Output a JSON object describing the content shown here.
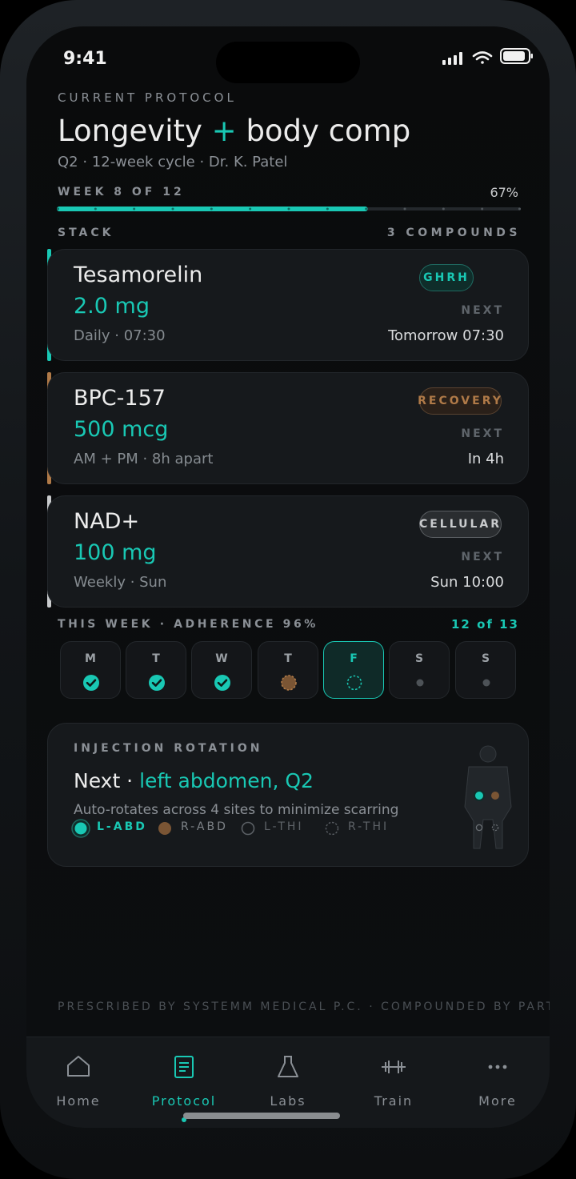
{
  "status": {
    "time": "9:41"
  },
  "header": {
    "eyebrow": "CURRENT PROTOCOL",
    "title_part1": "Longevity",
    "title_plus": "+",
    "title_part2": "body comp",
    "subtitle": "Q2 · 12-week cycle · Dr. K. Patel",
    "week_label": "WEEK 8 OF 12",
    "progress_label": "67%",
    "progress_fraction": 0.67,
    "weeks_total": 12
  },
  "stack": {
    "label": "STACK",
    "count_label": "3 COMPOUNDS",
    "next_label": "NEXT",
    "items": [
      {
        "name": "Tesamorelin",
        "dose": "2.0 mg",
        "schedule": "Daily · 07:30",
        "badge": "GHRH",
        "next": "Tomorrow 07:30",
        "accent": "#19c8b4"
      },
      {
        "name": "BPC-157",
        "dose": "500 mcg",
        "schedule": "AM + PM · 8h apart",
        "badge": "RECOVERY",
        "next": "In 4h",
        "accent": "#b07a48"
      },
      {
        "name": "NAD+",
        "dose": "100 mg",
        "schedule": "Weekly · Sun",
        "badge": "CELLULAR",
        "next": "Sun 10:00",
        "accent": "#c9cbcd"
      }
    ]
  },
  "week": {
    "label": "THIS WEEK · ADHERENCE 96%",
    "count": "12 of 13",
    "days": [
      {
        "letter": "M",
        "state": "done"
      },
      {
        "letter": "T",
        "state": "done"
      },
      {
        "letter": "W",
        "state": "done"
      },
      {
        "letter": "T",
        "state": "partial"
      },
      {
        "letter": "F",
        "state": "today"
      },
      {
        "letter": "S",
        "state": "upcoming"
      },
      {
        "letter": "S",
        "state": "upcoming"
      }
    ]
  },
  "rotation": {
    "label": "INJECTION ROTATION",
    "next_prefix": "Next ·",
    "next_site": "left abdomen, Q2",
    "description": "Auto-rotates across 4 sites to minimize scarring",
    "sites": [
      "L-ABD",
      "R-ABD",
      "L-THI",
      "R-THI"
    ]
  },
  "footer": {
    "text": "PRESCRIBED BY SYSTEMM MEDICAL P.C. · COMPOUNDED BY PARTNER PHARMACY"
  },
  "nav": {
    "items": [
      {
        "label": "Home",
        "icon": "home-icon"
      },
      {
        "label": "Protocol",
        "icon": "document-icon"
      },
      {
        "label": "Labs",
        "icon": "flask-icon"
      },
      {
        "label": "Train",
        "icon": "dumbbell-icon"
      },
      {
        "label": "More",
        "icon": "more-icon"
      }
    ],
    "active": "Protocol"
  },
  "colors": {
    "accent": "#19c8b4",
    "recovery": "#b07a48",
    "cellular": "#c9cbcd"
  }
}
